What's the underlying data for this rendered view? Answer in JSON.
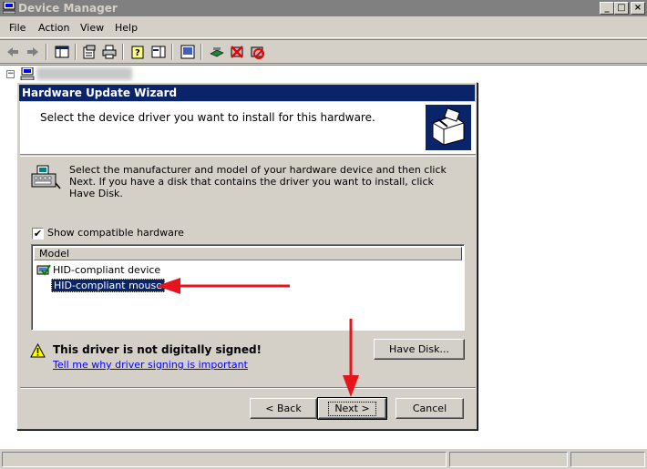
{
  "window": {
    "title": "Device Manager",
    "caption_buttons": [
      "_",
      "□",
      "×"
    ]
  },
  "menu": [
    "File",
    "Action",
    "View",
    "Help"
  ],
  "toolbar": {
    "icons": [
      "back-icon",
      "forward-icon",
      "up-icon",
      "properties-icon",
      "print-icon",
      "help-icon",
      "console-tree-icon",
      "scan-hardware-icon",
      "update-driver-icon",
      "uninstall-icon",
      "disable-icon"
    ]
  },
  "wizard": {
    "title": "Hardware Update Wizard",
    "header": "Select the device driver you want to install for this hardware.",
    "instructions": "Select the manufacturer and model of your hardware device and then click Next. If you have a disk that contains the driver you want to install, click Have Disk.",
    "show_compatible_label": "Show compatible hardware",
    "show_compatible_checked": true,
    "list": {
      "column": "Model",
      "items": [
        {
          "label": "HID-compliant device",
          "selected": false
        },
        {
          "label": "HID-compliant mouse",
          "selected": true
        }
      ]
    },
    "warning": "This driver is not digitally signed!",
    "warning_link": "Tell me why driver signing is important",
    "have_disk_label": "Have Disk...",
    "back_label": "< Back",
    "next_label": "Next >",
    "cancel_label": "Cancel"
  },
  "annotations": {
    "arrow_color": "#e8141b"
  }
}
